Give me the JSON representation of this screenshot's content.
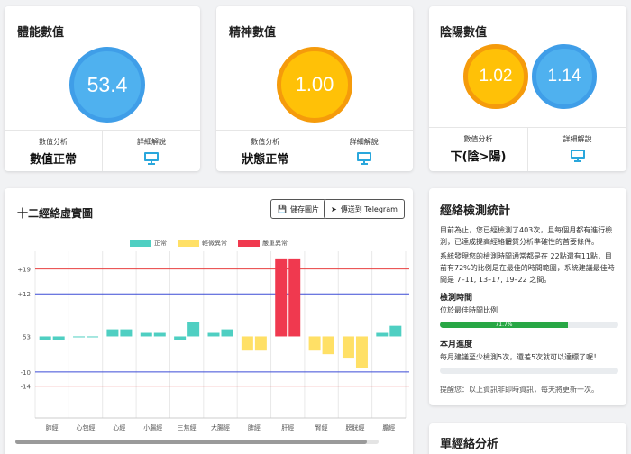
{
  "card1": {
    "title": "體能數值",
    "value": "53.4",
    "foot_label_1": "數值分析",
    "foot_value_1": "數值正常",
    "foot_label_2": "詳細解說",
    "icon": "monitor-icon"
  },
  "card2": {
    "title": "精神數值",
    "value": "1.00",
    "foot_label_1": "數值分析",
    "foot_value_1": "狀態正常",
    "foot_label_2": "詳細解說",
    "icon": "monitor-icon"
  },
  "card3": {
    "title": "陰陽數值",
    "value_1": "1.02",
    "value_2": "1.14",
    "foot_label_1": "數值分析",
    "foot_value_1": "下(陰>陽)",
    "foot_label_2": "詳細解說",
    "icon": "monitor-icon"
  },
  "chart_card": {
    "title": "十二經絡虛實圖",
    "save_label": "儲存圖片",
    "send_label": "傳送到 Telegram"
  },
  "chart_data": {
    "type": "bar",
    "categories": [
      "肺經",
      "心包經",
      "心經",
      "小腸經",
      "三焦經",
      "大腸經",
      "脾經",
      "肝經",
      "腎經",
      "膀胱經",
      "膽經"
    ],
    "series": [
      {
        "name": "正常",
        "values": [
          52,
          53,
          55,
          54,
          52,
          54,
          49,
          75,
          49,
          47,
          54
        ]
      },
      {
        "name": "正常",
        "values": [
          52,
          53,
          55,
          54,
          57,
          55,
          49,
          75,
          48,
          44,
          56
        ]
      }
    ],
    "legend": [
      "正常",
      "輕微異常",
      "嚴重異常"
    ],
    "y_ticks": [
      "+19",
      "+12",
      "53",
      "-10",
      "-14"
    ],
    "colors": {
      "normal": "#4fcfc2",
      "mild": "#ffe066",
      "severe": "#f0394f",
      "line_red": "#e84040",
      "line_blue": "#3b4bd6"
    }
  },
  "stats": {
    "title": "經絡檢測統計",
    "p1": "目前為止，您已經檢測了403次，且每個月都有進行檢測，已達成提高經絡體質分析準確性的首要條件。",
    "p2": "系統發現您的檢測時間通常都是在 22點還有11點，目前有72%的比例是在最佳的時間範圍，系統建議最佳時間是 7–11, 13–17, 19–22 之間。",
    "h1": "檢測時間",
    "h1_sub": "位於最佳時間比例",
    "progress_label": "71.7%",
    "progress_value": 71.7,
    "h2": "本月進度",
    "h2_sub": "每月建議至少檢測5次，還差5次就可以達標了喔！",
    "progress2_value": 0,
    "note": "提醒您：以上資訊非即時資訊，每天將更新一次。"
  },
  "single": {
    "title": "單經絡分析"
  }
}
